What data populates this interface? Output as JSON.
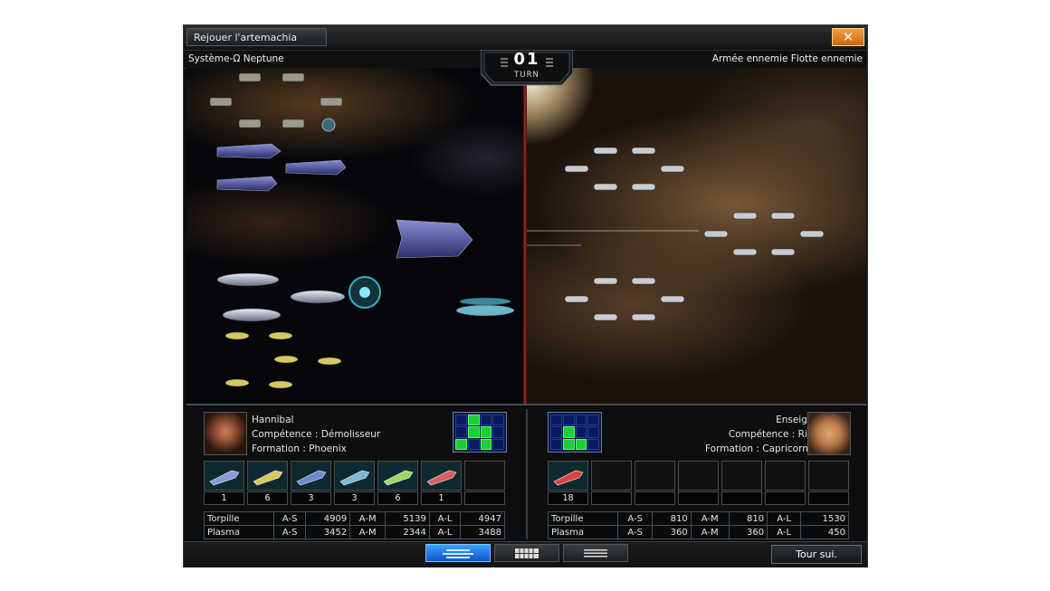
{
  "window": {
    "title": "Rejouer l'artemachia",
    "close_label": "✕"
  },
  "header": {
    "system": "Système-Ω Neptune",
    "enemy": "Armée ennemie Flotte ennemie",
    "turn_number": "01",
    "turn_label": "TURN"
  },
  "player": {
    "name": "Hannibal",
    "skill": "Compétence : Démolisseur",
    "formation": "Formation : Phoenix",
    "formation_cells": [
      0,
      1,
      0,
      0,
      0,
      1,
      1,
      0,
      1,
      0,
      1,
      0
    ],
    "slots": [
      {
        "icon": "stealth-cruiser-icon",
        "count": "1"
      },
      {
        "icon": "yellow-carrier-icon",
        "count": "6"
      },
      {
        "icon": "battleship-icon",
        "count": "3"
      },
      {
        "icon": "destroyer-icon",
        "count": "3"
      },
      {
        "icon": "green-frigate-icon",
        "count": "6"
      },
      {
        "icon": "red-frigate-icon",
        "count": "1"
      },
      {
        "icon": "",
        "count": ""
      }
    ],
    "stats": [
      {
        "weapon": "Torpille",
        "as_label": "A-S",
        "as": "4909",
        "am_label": "A-M",
        "am": "5139",
        "al_label": "A-L",
        "al": "4947"
      },
      {
        "weapon": "Plasma",
        "as_label": "A-S",
        "as": "3452",
        "am_label": "A-M",
        "am": "2344",
        "al_label": "A-L",
        "al": "3488"
      }
    ]
  },
  "enemy": {
    "name": "Enseigne",
    "skill": "Compétence : Rien",
    "formation": "Formation : Capricornus",
    "formation_cells": [
      0,
      0,
      0,
      0,
      0,
      1,
      0,
      0,
      0,
      1,
      1,
      0
    ],
    "slots": [
      {
        "icon": "red-cruiser-icon",
        "count": "18"
      },
      {
        "icon": "",
        "count": ""
      },
      {
        "icon": "",
        "count": ""
      },
      {
        "icon": "",
        "count": ""
      },
      {
        "icon": "",
        "count": ""
      },
      {
        "icon": "",
        "count": ""
      },
      {
        "icon": "",
        "count": ""
      }
    ],
    "stats": [
      {
        "weapon": "Torpille",
        "as_label": "A-S",
        "as": "810",
        "am_label": "A-M",
        "am": "810",
        "al_label": "A-L",
        "al": "1530"
      },
      {
        "weapon": "Plasma",
        "as_label": "A-S",
        "as": "360",
        "am_label": "A-M",
        "am": "360",
        "al_label": "A-L",
        "al": "450"
      }
    ]
  },
  "bottom": {
    "next_turn": "Tour sui.",
    "views": [
      "battle-view-icon",
      "grid-view-icon",
      "list-view-icon"
    ]
  },
  "colors": {
    "accent_blue": "#1f6fe0",
    "close_orange": "#e0801e",
    "formation_on": "#1ecc3c",
    "formation_bg": "#0a1a5c"
  }
}
